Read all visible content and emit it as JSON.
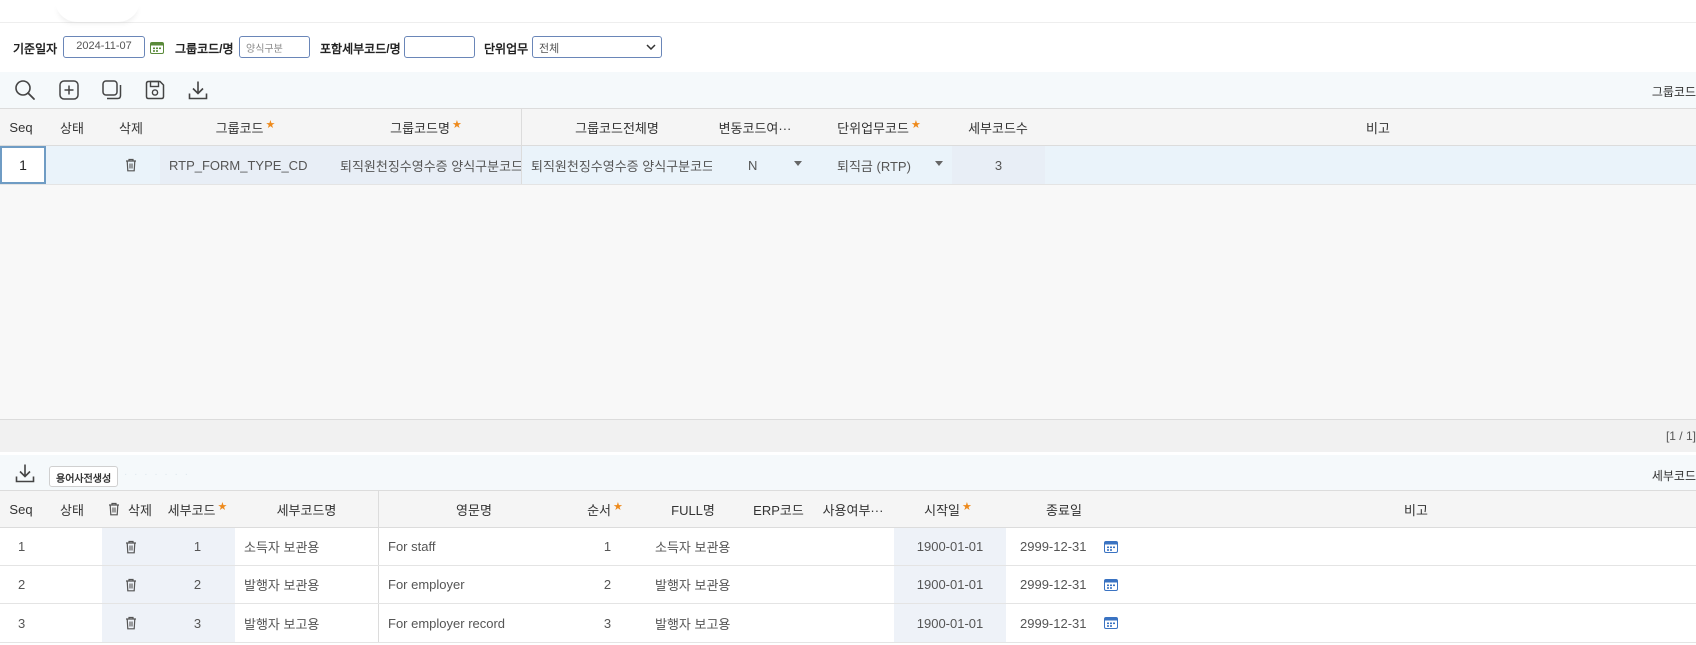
{
  "filters": {
    "base_date_label": "기준일자",
    "base_date_value": "2024-11-07",
    "group_code_label": "그룹코드/명",
    "group_code_value": "양식구분",
    "detail_code_label": "포함세부코드/명",
    "detail_code_value": "",
    "unit_task_label": "단위업무",
    "unit_task_value": "전체"
  },
  "top_toolbar": {
    "icons": [
      "search-icon",
      "add-icon",
      "copy-icon",
      "save-icon",
      "download-icon"
    ],
    "right_label": "그룹코드"
  },
  "group_grid": {
    "headers": {
      "seq": "Seq",
      "status": "상태",
      "delete": "삭제",
      "group_code": "그룹코드",
      "group_name": "그룹코드명",
      "group_full_name": "그룹코드전체명",
      "variable_flag": "변동코드여···",
      "unit_task_code": "단위업무코드",
      "detail_count": "세부코드수",
      "remark": "비고"
    },
    "rows": [
      {
        "seq": "1",
        "status": "",
        "group_code": "RTP_FORM_TYPE_CD",
        "group_name": "퇴직원천징수영수증 양식구분코드",
        "group_full_name": "퇴직원천징수영수증 양식구분코드",
        "variable_flag": "N",
        "unit_task_code": "퇴직금 (RTP)",
        "detail_count": "3",
        "remark": ""
      }
    ],
    "pager": "[1 / 1]"
  },
  "detail_toolbar": {
    "dictionary_button": "용어사전생성",
    "right_label": "세부코드"
  },
  "detail_grid": {
    "headers": {
      "seq": "Seq",
      "status": "상태",
      "delete": "삭제",
      "detail_code": "세부코드",
      "detail_name": "세부코드명",
      "english_name": "영문명",
      "order": "순서",
      "full_name": "FULL명",
      "erp_code": "ERP코드",
      "use_flag": "사용여부···",
      "start_date": "시작일",
      "end_date": "종료일",
      "remark": "비고"
    },
    "rows": [
      {
        "seq": "1",
        "status": "",
        "detail_code": "1",
        "detail_name": "소득자 보관용",
        "english_name": "For staff",
        "order": "1",
        "full_name": "소득자 보관용",
        "erp_code": "",
        "use_flag": "",
        "start_date": "1900-01-01",
        "end_date": "2999-12-31",
        "remark": ""
      },
      {
        "seq": "2",
        "status": "",
        "detail_code": "2",
        "detail_name": "발행자 보관용",
        "english_name": "For employer",
        "order": "2",
        "full_name": "발행자 보관용",
        "erp_code": "",
        "use_flag": "",
        "start_date": "1900-01-01",
        "end_date": "2999-12-31",
        "remark": ""
      },
      {
        "seq": "3",
        "status": "",
        "detail_code": "3",
        "detail_name": "발행자 보고용",
        "english_name": "For employer record",
        "order": "3",
        "full_name": "발행자 보고용",
        "erp_code": "",
        "use_flag": "",
        "start_date": "1900-01-01",
        "end_date": "2999-12-31",
        "remark": ""
      }
    ]
  },
  "colors": {
    "accent_border": "#6a86b8",
    "required_marker": "#ee8a1c",
    "selected_row": "#eaf3fa",
    "calendar_icon": "#3a73c2"
  }
}
